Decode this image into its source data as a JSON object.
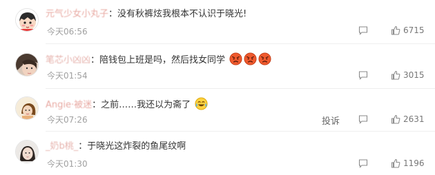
{
  "comments": [
    {
      "username": "元气少女小丸子",
      "separator": "：",
      "text": "没有秋裤炫我根本不认识于晓光!",
      "time": "今天06:56",
      "likes": "6715"
    },
    {
      "username": "笔芯小凶凶",
      "separator": "：",
      "text": "陪钱包上班是吗，然后找女同学",
      "time": "今天01:54",
      "likes": "3015"
    },
    {
      "username": "Angie·被迷",
      "separator": "：",
      "text": "之前……我还以为斋了",
      "time": "今天07:26",
      "likes": "2631",
      "report": "投诉"
    },
    {
      "username": "_奶b桃_",
      "separator": "：",
      "text": "于晓光这炸裂的鱼尾纹啊",
      "time": "今天01:30",
      "likes": "1196"
    }
  ],
  "icons": {
    "comment": "comment-icon",
    "like": "thumb-up-icon",
    "angry_emoji": "angry-face-emoji",
    "laugh_cry_emoji": "laugh-cry-emoji"
  }
}
